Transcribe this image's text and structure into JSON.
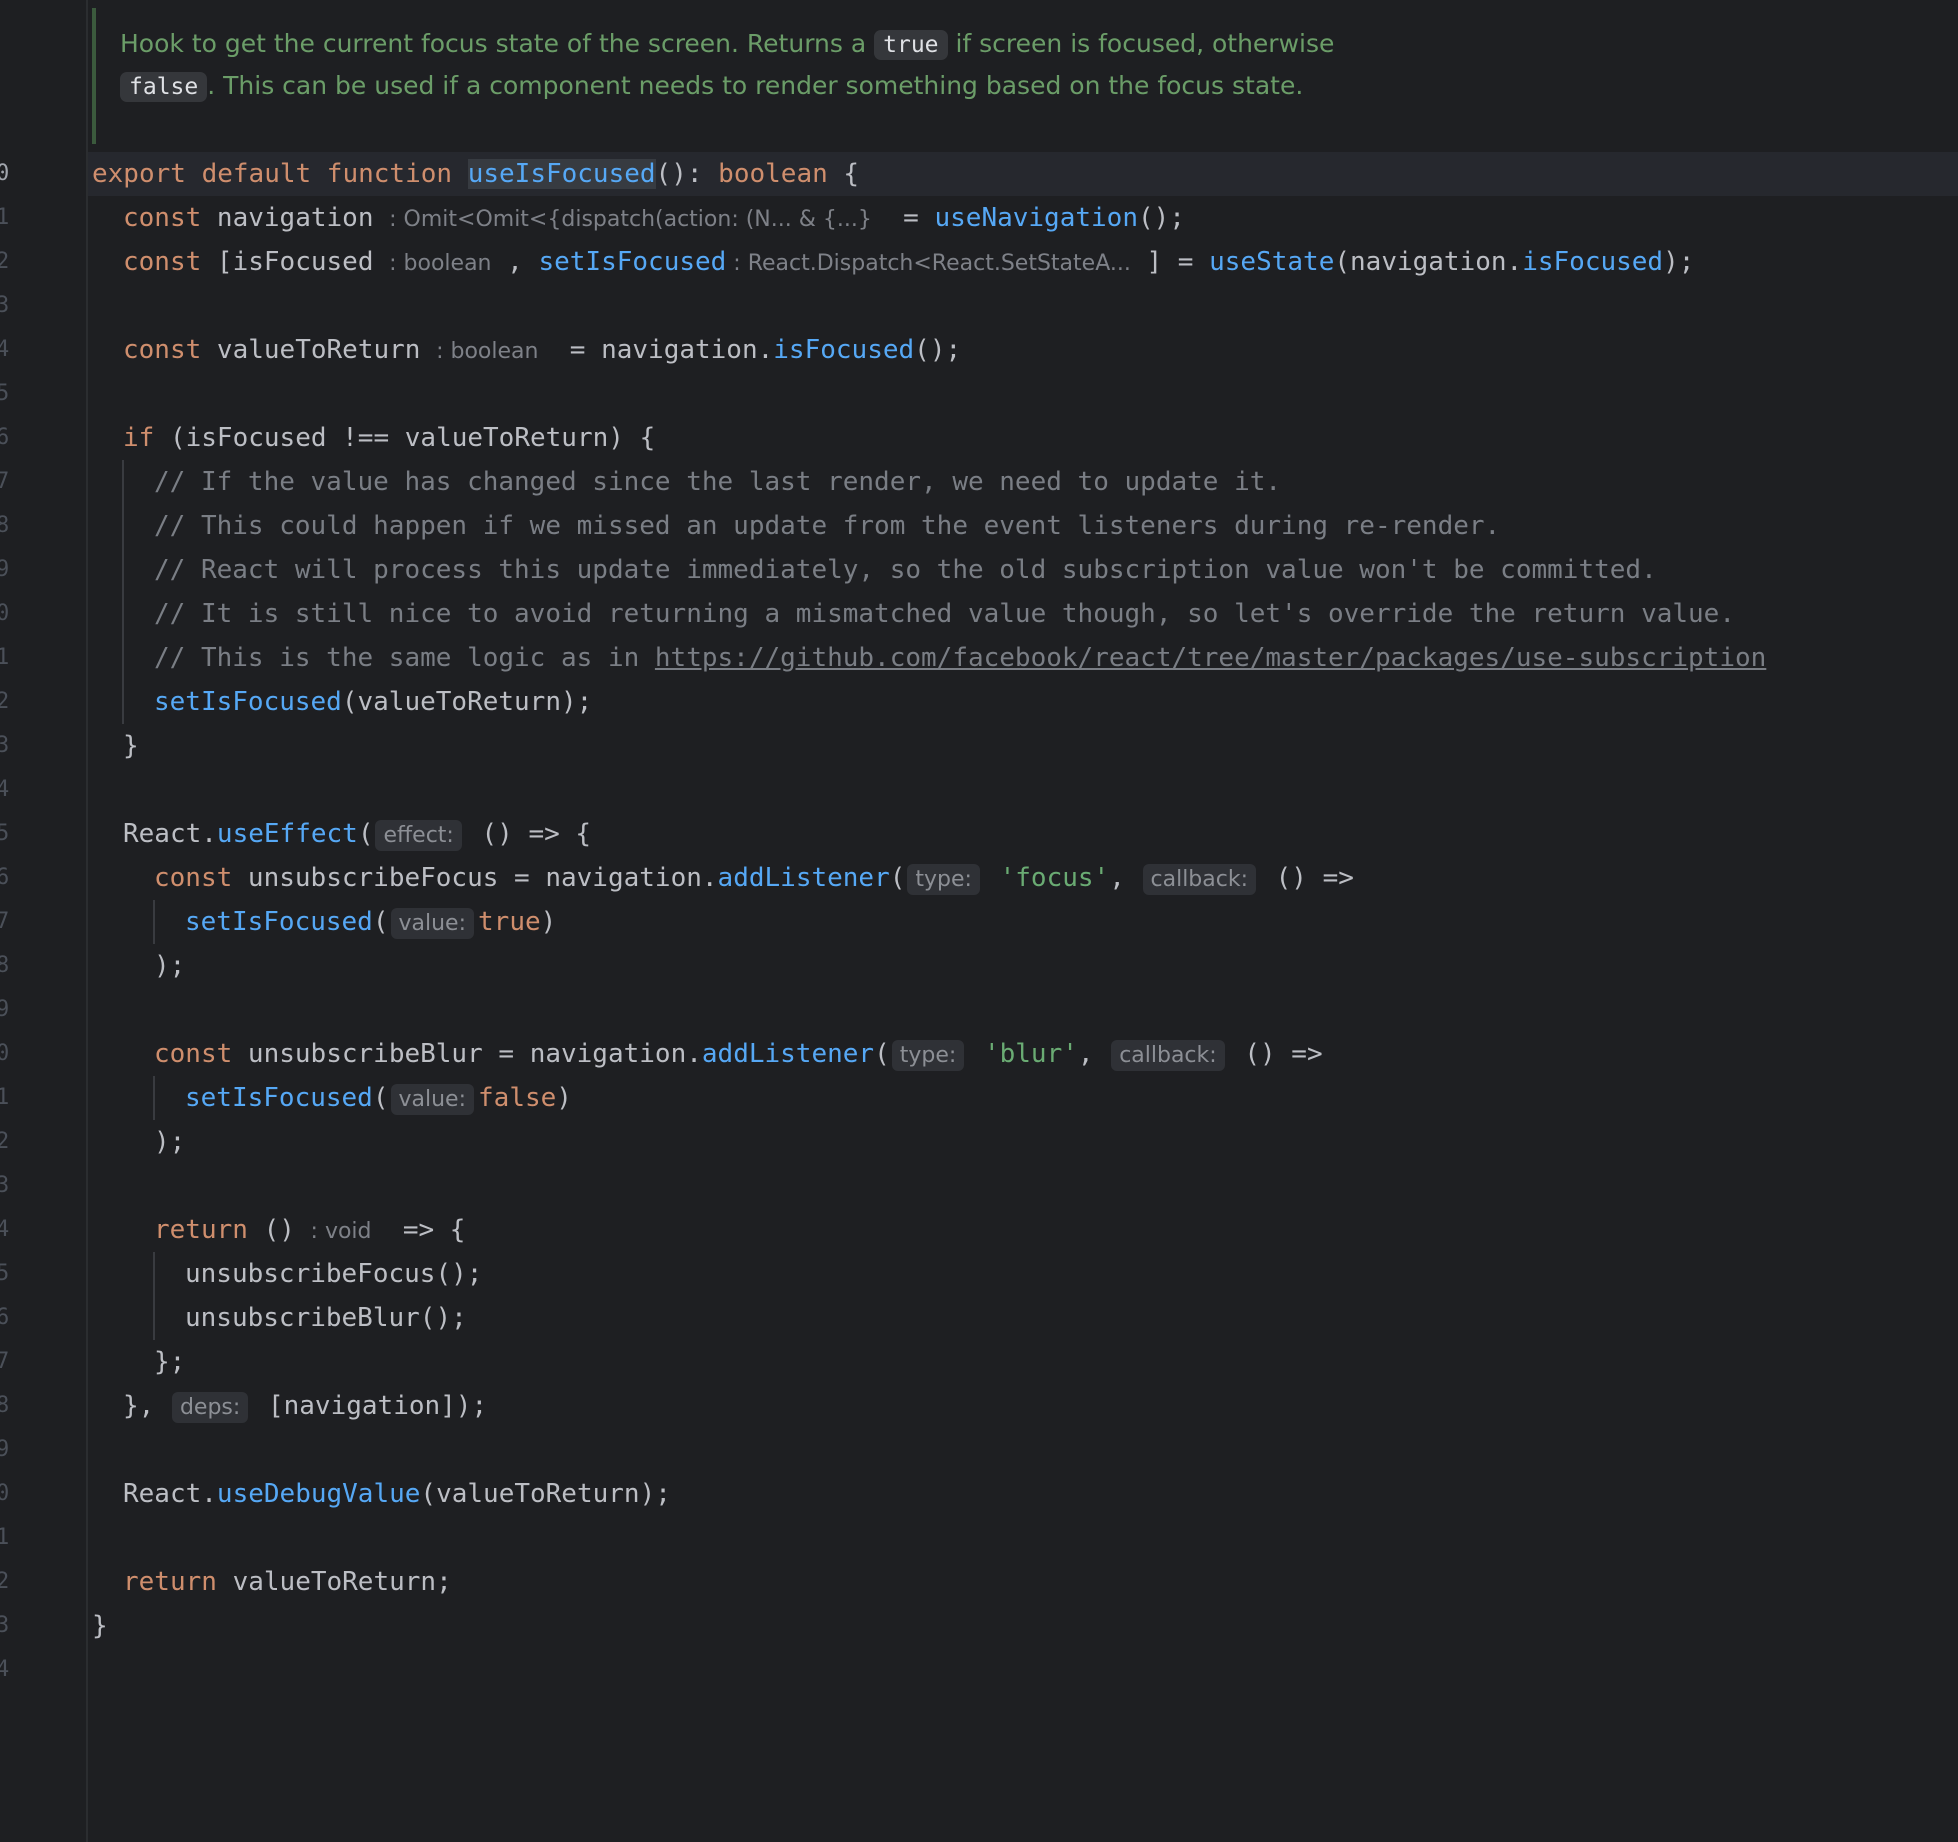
{
  "editor": {
    "line_numbers": [
      "0",
      "1",
      "2",
      "3",
      "4",
      "5",
      "6",
      "7",
      "8",
      "9",
      "0",
      "1",
      "2",
      "3",
      "4",
      "5",
      "6",
      "7",
      "8",
      "9",
      "0",
      "1",
      "2",
      "3",
      "4",
      "5",
      "6",
      "7",
      "8",
      "9",
      "0",
      "1",
      "2",
      "3",
      "4"
    ],
    "doc_comment": {
      "line1_before": "Hook to get the current focus state of the screen. Returns a ",
      "line1_code": "true",
      "line1_after": " if screen is focused, otherwise",
      "line2_code": "false",
      "line2_after": ". This can be used if a component needs to render something based on the focus state."
    },
    "code": {
      "l0": {
        "export": "export",
        "default": " default",
        "function": " function",
        "name": "useIsFocused",
        "sig": "(): ",
        "ret": "boolean",
        "brace": " {"
      },
      "l1": {
        "const": "const",
        "var": " navigation ",
        "hint": ": Omit<Omit<{dispatch(action: (N... & {...}",
        "eq": "  = ",
        "call": "useNavigation",
        "end": "();"
      },
      "l2": {
        "const": "const",
        "open": " [isFocused ",
        "hint1": ": boolean",
        "comma": " , ",
        "setter": "setIsFocused",
        "hint2": " : React.Dispatch<React.SetStateA...",
        "mid": " ] = ",
        "call": "useState",
        "arg_open": "(navigation.",
        "prop": "isFocused",
        "end": ");"
      },
      "l4": {
        "const": "const",
        "var": " valueToReturn ",
        "hint": ": boolean",
        "eq": "  = navigation.",
        "call": "isFocused",
        "end": "();"
      },
      "l6": {
        "if": "if",
        "rest": " (isFocused !== valueToReturn) {"
      },
      "l7": "// If the value has changed since the last render, we need to update it.",
      "l8": "// This could happen if we missed an update from the event listeners during re-render.",
      "l9": "// React will process this update immediately, so the old subscription value won't be committed.",
      "l10": "// It is still nice to avoid returning a mismatched value though, so let's override the return value.",
      "l11_text": "// This is the same logic as in ",
      "l11_url": "https://github.com/facebook/react/tree/master/packages/use-subscription",
      "l12": {
        "call": "setIsFocused",
        "rest": "(valueToReturn);"
      },
      "l13": "}",
      "l15": {
        "obj": "React.",
        "call": "useEffect",
        "open": "(",
        "hint": "effect:",
        "rest": " () => {"
      },
      "l16": {
        "const": "const",
        "var": " unsubscribeFocus = navigation.",
        "call": "addListener",
        "open": "(",
        "hint1": "type:",
        "str": " 'focus'",
        "comma": ",",
        "hint2": "callback:",
        "rest": " () =>"
      },
      "l17": {
        "call": "setIsFocused",
        "open": "(",
        "hint": "value:",
        "val": "true",
        "end": ")"
      },
      "l18": ");",
      "l20": {
        "const": "const",
        "var": " unsubscribeBlur = navigation.",
        "call": "addListener",
        "open": "(",
        "hint1": "type:",
        "str": " 'blur'",
        "comma": ",",
        "hint2": "callback:",
        "rest": " () =>"
      },
      "l21": {
        "call": "setIsFocused",
        "open": "(",
        "hint": "value:",
        "val": "false",
        "end": ")"
      },
      "l22": ");",
      "l24": {
        "return": "return",
        "paren": " () ",
        "hint": ": void",
        "rest": "  => {"
      },
      "l25": "unsubscribeFocus();",
      "l26": "unsubscribeBlur();",
      "l27": "};",
      "l28": {
        "close": "}, ",
        "hint": "deps:",
        "rest": " [navigation]);"
      },
      "l30": {
        "obj": "React.",
        "call": "useDebugValue",
        "rest": "(valueToReturn);"
      },
      "l32": {
        "return": "return",
        "rest": " valueToReturn;"
      },
      "l33": "}"
    }
  },
  "colors": {
    "background": "#1e1f22",
    "keyword": "#cf8e6d",
    "function": "#56a8f5",
    "string": "#6aab73",
    "comment": "#7a7e85",
    "doc_comment": "#6b9d68"
  }
}
